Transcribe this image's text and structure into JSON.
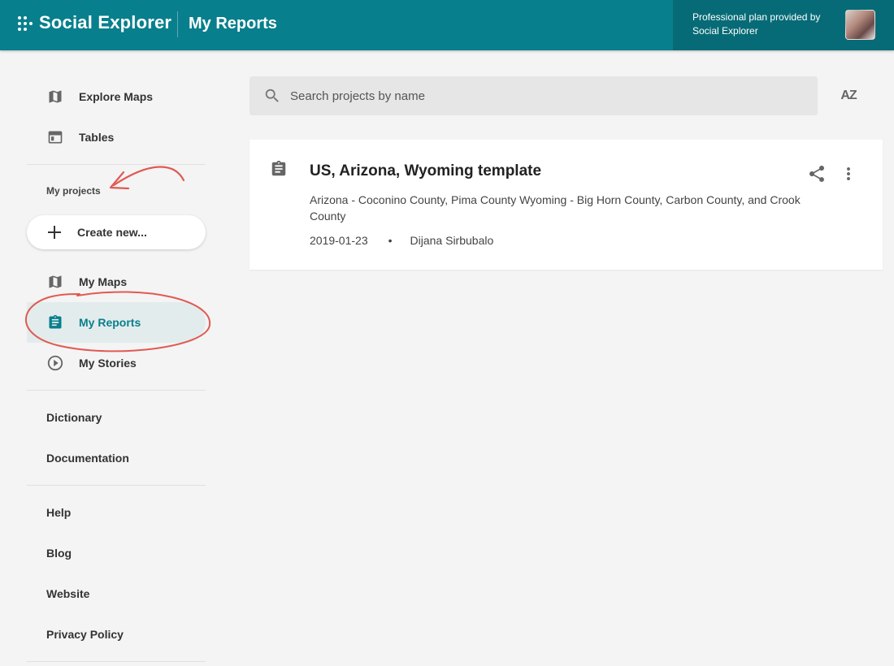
{
  "header": {
    "logo_text": "Social Explorer",
    "page_title": "My Reports",
    "plan_text": "Professional plan provided by Social Explorer",
    "accent_color": "#087f8c"
  },
  "sidebar": {
    "top_items": [
      {
        "label": "Explore Maps",
        "icon": "map-icon"
      },
      {
        "label": "Tables",
        "icon": "table-icon"
      }
    ],
    "section_label": "My projects",
    "create_label": "Create new...",
    "project_items": [
      {
        "label": "My Maps",
        "icon": "map-icon"
      },
      {
        "label": "My Reports",
        "icon": "report-icon",
        "active": true
      },
      {
        "label": "My Stories",
        "icon": "play-circle-icon"
      }
    ],
    "ref_items": [
      {
        "label": "Dictionary"
      },
      {
        "label": "Documentation"
      }
    ],
    "info_items": [
      {
        "label": "Help"
      },
      {
        "label": "Blog"
      },
      {
        "label": "Website"
      },
      {
        "label": "Privacy Policy"
      }
    ]
  },
  "search": {
    "placeholder": "Search projects by name",
    "value": ""
  },
  "sort_label": "AZ",
  "reports": [
    {
      "title": "US, Arizona, Wyoming template",
      "description": "Arizona - Coconino County, Pima County Wyoming - Big Horn County, Carbon County, and Crook County",
      "date": "2019-01-23",
      "separator": "•",
      "author": "Dijana Sirbubalo"
    }
  ]
}
